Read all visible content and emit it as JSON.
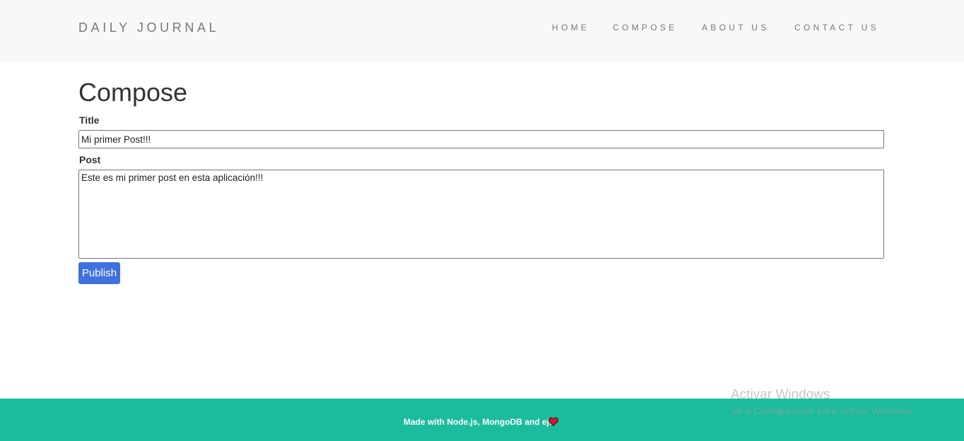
{
  "header": {
    "brand": "DAILY JOURNAL",
    "nav": [
      {
        "label": "HOME"
      },
      {
        "label": "COMPOSE"
      },
      {
        "label": "ABOUT US"
      },
      {
        "label": "CONTACT US"
      }
    ]
  },
  "main": {
    "heading": "Compose",
    "title_label": "Title",
    "title_value": "Mi primer Post!!!",
    "post_label": "Post",
    "post_value": "Este es mi primer post en esta aplicación!!!",
    "publish_label": "Publish"
  },
  "footer": {
    "text": "Made with Node.js, MongoDB and ejs",
    "heart_icon": "heart-icon",
    "heart_color": "#e0112b"
  },
  "watermark": {
    "title": "Activar Windows",
    "subtitle": "Ve a Configuración para activar Windows."
  },
  "colors": {
    "navbar_bg": "#f8f8f8",
    "footer_bg": "#1abc9c",
    "button_bg": "#3f71e0"
  }
}
